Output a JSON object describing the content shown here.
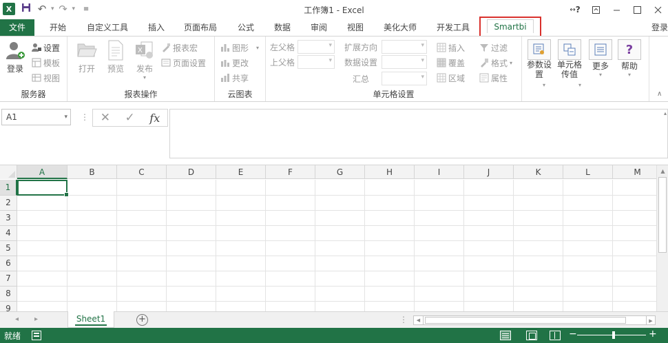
{
  "window": {
    "title": "工作簿1 - Excel",
    "app_logo": "X",
    "help_label": "?",
    "controls": [
      "help-icon",
      "restore-ribbon-icon",
      "minimize-icon",
      "maximize-icon",
      "close-icon"
    ]
  },
  "qat": {
    "icons": [
      "excel-logo",
      "save-icon",
      "undo-icon",
      "redo-icon",
      "customize-qat-icon"
    ]
  },
  "tabs": [
    {
      "label": "文件"
    },
    {
      "label": "开始"
    },
    {
      "label": "自定义工具"
    },
    {
      "label": "插入"
    },
    {
      "label": "页面布局"
    },
    {
      "label": "公式"
    },
    {
      "label": "数据"
    },
    {
      "label": "审阅"
    },
    {
      "label": "视图"
    },
    {
      "label": "美化大师"
    },
    {
      "label": "开发工具"
    },
    {
      "label": "Smartbi"
    }
  ],
  "login_link": "登录",
  "ribbon": {
    "server": {
      "group_label": "服务器",
      "login": "登录",
      "settings": "设置",
      "template": "模板",
      "view": "视图"
    },
    "report": {
      "group_label": "报表操作",
      "open": "打开",
      "preview": "预览",
      "publish": "发布",
      "report_macro": "报表宏",
      "page_setup": "页面设置"
    },
    "cloud": {
      "group_label": "云图表",
      "chart": "图形",
      "change": "更改",
      "share": "共享"
    },
    "cell": {
      "group_label": "单元格设置",
      "left_parent": "左父格",
      "top_parent": "上父格",
      "expand_direction": "扩展方向",
      "data_setting": "数据设置",
      "summary": "汇总",
      "insert": "插入",
      "cover": "覆盖",
      "region": "区域",
      "filter": "过滤",
      "format": "格式",
      "attribute": "属性"
    },
    "extra": {
      "param_setting": "参数设\n置",
      "cell_passing": "单元格\n传值",
      "more": "更多",
      "help": "帮助"
    }
  },
  "formula_bar": {
    "name_box": "A1",
    "formula": ""
  },
  "grid": {
    "columns": [
      "A",
      "B",
      "C",
      "D",
      "E",
      "F",
      "G",
      "H",
      "I",
      "J",
      "K",
      "L",
      "M"
    ],
    "rows": [
      "1",
      "2",
      "3",
      "4",
      "5",
      "6",
      "7",
      "8",
      "9"
    ],
    "active_cell": "A1"
  },
  "sheets": [
    {
      "label": "Sheet1",
      "active": true
    }
  ],
  "status": {
    "text": "就绪",
    "view_mode": "normal"
  },
  "colors": {
    "accent": "#217346",
    "highlight_border": "#d9302c"
  }
}
